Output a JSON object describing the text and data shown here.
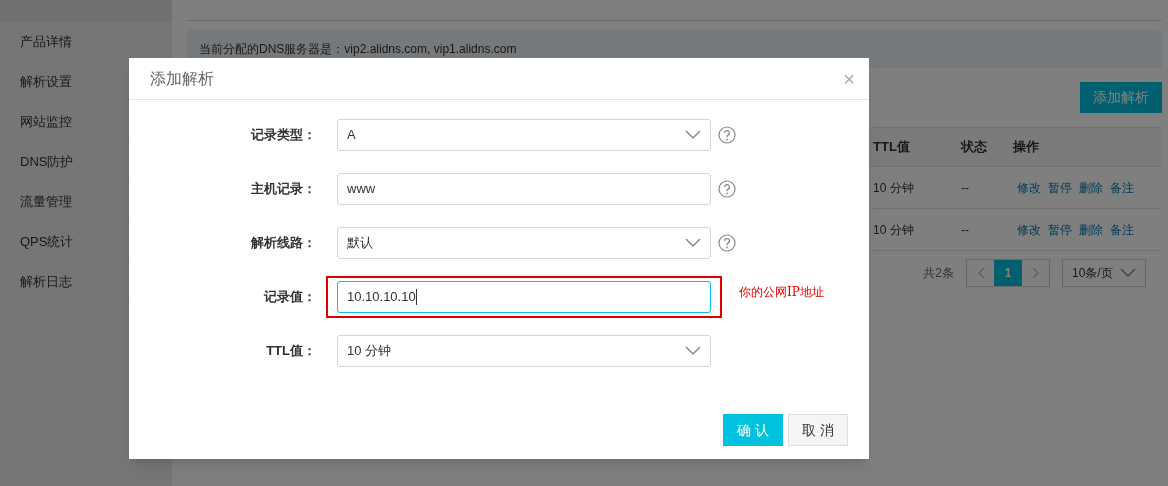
{
  "sidebar": {
    "items": [
      {
        "label": "产品详情"
      },
      {
        "label": "解析设置"
      },
      {
        "label": "网站监控"
      },
      {
        "label": "DNS防护"
      },
      {
        "label": "流量管理"
      },
      {
        "label": "QPS统计"
      },
      {
        "label": "解析日志"
      }
    ]
  },
  "info": "当前分配的DNS服务器是：vip2.alidns.com, vip1.alidns.com",
  "add_button": "添加解析",
  "table": {
    "columns": [
      "TTL值",
      "状态",
      "操作"
    ],
    "rows": [
      {
        "ttl": "10 分钟",
        "status": "--",
        "actions": [
          "修改",
          "暂停",
          "删除",
          "备注"
        ]
      },
      {
        "ttl": "10 分钟",
        "status": "--",
        "actions": [
          "修改",
          "暂停",
          "删除",
          "备注"
        ]
      }
    ]
  },
  "pagination": {
    "total": "共2条",
    "pages": [
      {
        "label": "1",
        "selected": true
      }
    ],
    "page_size": "10条/页"
  },
  "dialog": {
    "title": "添加解析",
    "close": "×",
    "fields": [
      {
        "label": "记录类型：",
        "kind": "select",
        "value": "A",
        "help": true,
        "highlighted": false
      },
      {
        "label": "主机记录：",
        "kind": "input",
        "value": "www",
        "help": true,
        "highlighted": false
      },
      {
        "label": "解析线路：",
        "kind": "select",
        "value": "默认",
        "help": true,
        "highlighted": false
      },
      {
        "label": "记录值：",
        "kind": "input",
        "value": "10.10.10.10",
        "help": false,
        "highlighted": true,
        "note": "你的公网IP地址"
      },
      {
        "label": "TTL值：",
        "kind": "select",
        "value": "10 分钟",
        "help": false,
        "highlighted": false
      }
    ],
    "buttons": [
      {
        "label": "确 认",
        "kind": "primary"
      },
      {
        "label": "取 消",
        "kind": "secondary"
      }
    ]
  }
}
